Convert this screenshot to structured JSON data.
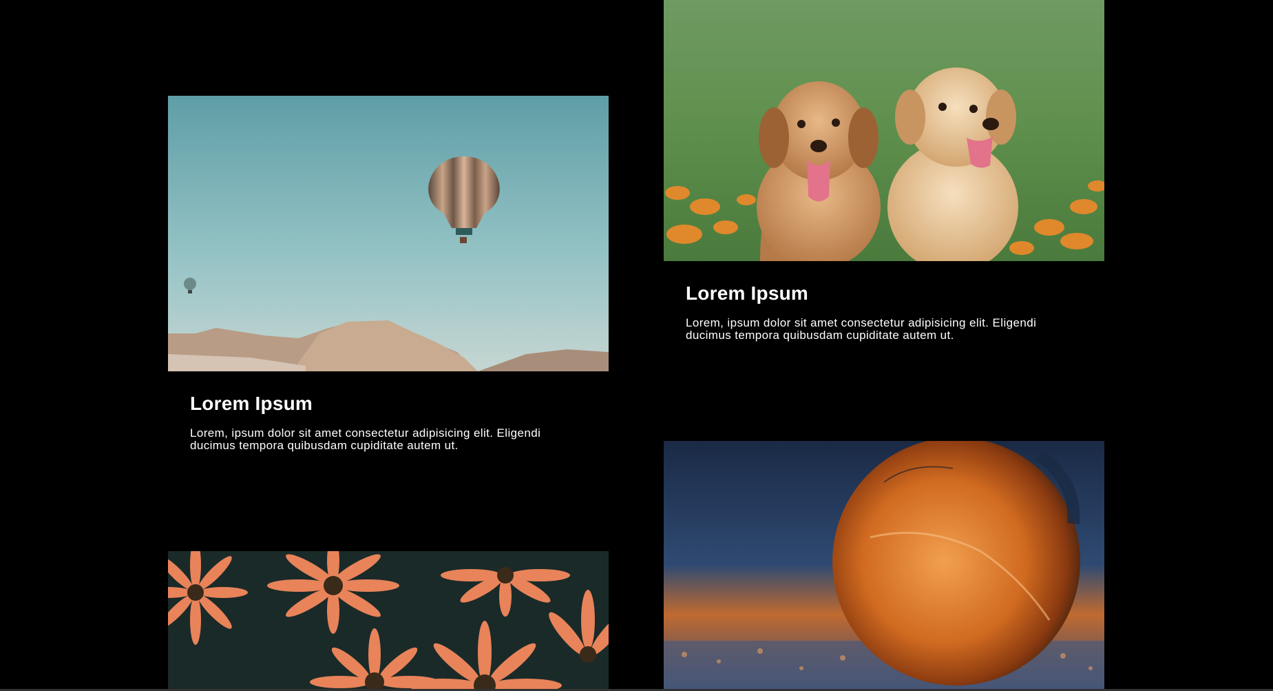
{
  "cards": [
    {
      "image": "hot-air-balloons-over-desert",
      "title": "Lorem Ipsum",
      "body": "Lorem, ipsum dolor sit amet consectetur adipisicing elit. Eligendi ducimus tempora quibusdam cupiditate autem ut."
    },
    {
      "image": "two-golden-retriever-puppies",
      "title": "Lorem Ipsum",
      "body": "Lorem, ipsum dolor sit amet consectetur adipisicing elit. Eligendi ducimus tempora quibusdam cupiditate autem ut."
    },
    {
      "image": "orange-daisy-flowers"
    },
    {
      "image": "frozen-bubble-at-sunset"
    }
  ],
  "colors": {
    "background": "#000000",
    "text": "#ffffff"
  }
}
